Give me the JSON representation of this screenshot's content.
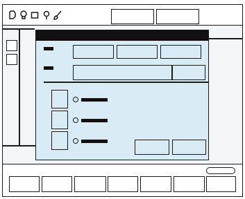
{
  "toolbar": {
    "tools": [
      "pen-icon",
      "bulb-icon",
      "square-icon",
      "pin-icon",
      "brush-icon"
    ],
    "buttons": [
      "top-button-1",
      "top-button-2"
    ]
  },
  "sidebar": {
    "buttons": [
      "side-button-1",
      "side-button-2"
    ]
  },
  "dialog": {
    "row1": {
      "inputs": [
        "input-a",
        "input-b",
        "input-c"
      ]
    },
    "row2": {
      "inputs": [
        "wide-input",
        "small-input"
      ]
    },
    "options": [
      {
        "name": "option-1",
        "selected": false
      },
      {
        "name": "option-2",
        "selected": false
      },
      {
        "name": "option-3",
        "selected": false
      }
    ],
    "actions": [
      "ok-button",
      "cancel-button"
    ]
  },
  "bottom": {
    "tab_count": 7,
    "toggle": "pill-toggle"
  },
  "colors": {
    "dialog_bg": "#d9ecf5",
    "title_bar": "#111111",
    "outline": "#1a1a1a",
    "panel_bg": "#f3f5f6"
  }
}
